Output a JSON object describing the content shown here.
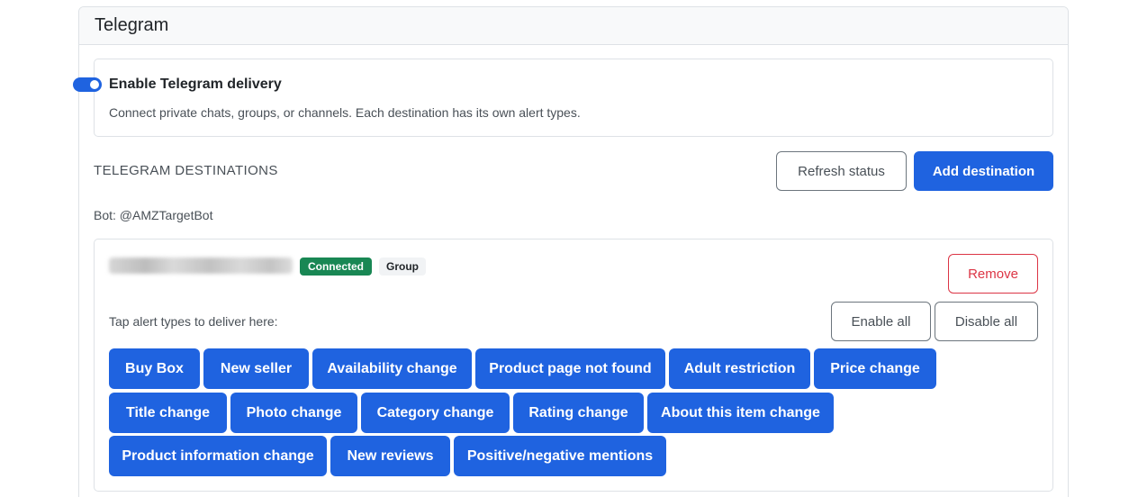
{
  "section": {
    "title": "Telegram"
  },
  "enable": {
    "label": "Enable Telegram delivery",
    "help": "Connect private chats, groups, or channels. Each destination has its own alert types.",
    "enabled": true
  },
  "destinations": {
    "heading": "TELEGRAM DESTINATIONS",
    "refresh_label": "Refresh status",
    "add_label": "Add destination",
    "bot_line": "Bot: @AMZTargetBot",
    "items": [
      {
        "status": "Connected",
        "type": "Group",
        "remove_label": "Remove",
        "tap_label": "Tap alert types to deliver here:",
        "enable_all_label": "Enable all",
        "disable_all_label": "Disable all",
        "alert_types": [
          "Buy Box",
          "New seller",
          "Availability change",
          "Product page not found",
          "Adult restriction",
          "Price change",
          "Title change",
          "Photo change",
          "Category change",
          "Rating change",
          "About this item change",
          "Product information change",
          "New reviews",
          "Positive/negative mentions"
        ]
      }
    ]
  },
  "colors": {
    "primary": "#1f63e0",
    "success": "#198754",
    "danger": "#dc3545"
  }
}
